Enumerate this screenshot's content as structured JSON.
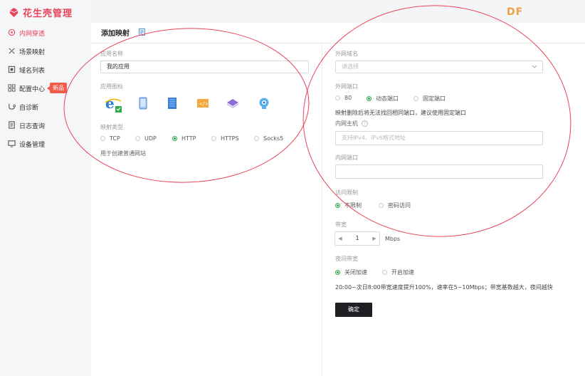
{
  "brand": {
    "name": "花生壳管理",
    "color": "#e8445a"
  },
  "watermark": "DF",
  "sidebar": {
    "items": [
      {
        "label": "内网穿透",
        "icon": "network-icon",
        "active": true
      },
      {
        "label": "场景映射",
        "icon": "scene-icon"
      },
      {
        "label": "域名列表",
        "icon": "domain-icon"
      },
      {
        "label": "配置中心",
        "icon": "grid-icon",
        "badge": "新品"
      },
      {
        "label": "自诊断",
        "icon": "diagnose-icon"
      },
      {
        "label": "日志查询",
        "icon": "log-icon"
      },
      {
        "label": "设备管理",
        "icon": "device-icon"
      }
    ]
  },
  "page": {
    "title": "添加映射",
    "doc_icon": "document-icon"
  },
  "left": {
    "app_name_label": "应用名称",
    "app_name_value": "我的应用",
    "app_icon_label": "应用图标",
    "icons": [
      "ie-icon",
      "phone-icon",
      "book-icon",
      "code-icon",
      "stack-icon",
      "camera-icon"
    ],
    "map_type_label": "映射类型",
    "map_types": [
      {
        "label": "TCP",
        "checked": false
      },
      {
        "label": "UDP",
        "checked": false
      },
      {
        "label": "HTTP",
        "checked": true
      },
      {
        "label": "HTTPS",
        "checked": false
      },
      {
        "label": "Socks5",
        "checked": false
      }
    ],
    "map_type_hint": "用于创建普通网站"
  },
  "right": {
    "domain_label": "外网域名",
    "domain_placeholder": "请选择",
    "port_label": "外网端口",
    "port_options": [
      {
        "label": "80",
        "checked": false
      },
      {
        "label": "动态端口",
        "checked": true
      },
      {
        "label": "固定端口",
        "checked": false
      }
    ],
    "port_hint": "映射删除后将无法找回相同端口，建议使用固定端口",
    "host_label": "内网主机",
    "host_help": "?",
    "host_placeholder": "支持IPv4、IPv6格式地址",
    "inner_port_label": "内网端口",
    "access_label": "访问限制",
    "access_options": [
      {
        "label": "不限制",
        "checked": true
      },
      {
        "label": "密码访问",
        "checked": false
      }
    ],
    "bandwidth_label": "带宽",
    "bandwidth_value": "1",
    "bandwidth_unit": "Mbps",
    "night_label": "夜间带宽",
    "night_options": [
      {
        "label": "关闭加速",
        "checked": true
      },
      {
        "label": "开启加速",
        "checked": false
      }
    ],
    "night_hint": "20:00~次日8:00带宽速度提升100%，速率在5~10Mbps；带宽基数越大，夜间越快",
    "confirm_label": "确定"
  },
  "colors": {
    "accent": "#e8445a",
    "green": "#2eaa4b",
    "annotation": "#e8445a"
  }
}
